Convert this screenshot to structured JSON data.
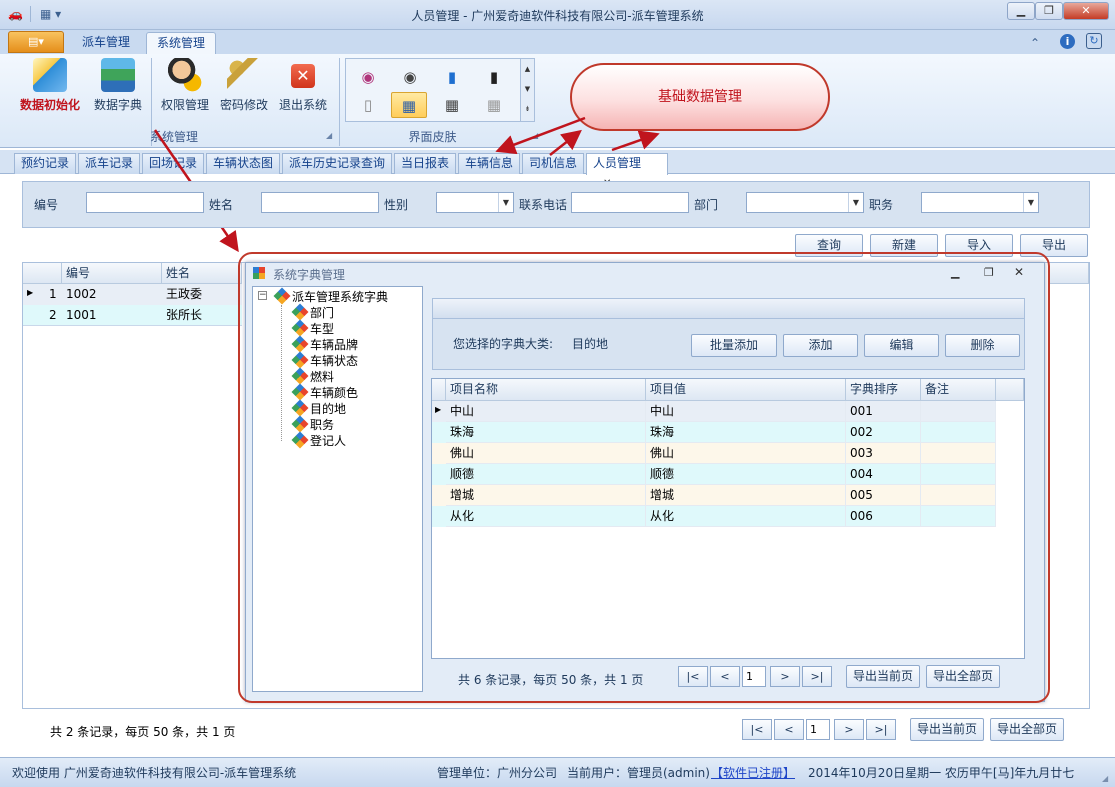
{
  "window": {
    "title": "人员管理 - 广州爱奇迪软件科技有限公司-派车管理系统",
    "min": "▁",
    "max": "❐",
    "close": "✕"
  },
  "ribbon": {
    "tabs": [
      "派车管理",
      "系统管理"
    ],
    "app_button": "▤▾",
    "buttons": [
      "数据初始化",
      "数据字典",
      "权限管理",
      "密码修改",
      "退出系统"
    ],
    "group_system": "系统管理",
    "group_skin": "界面皮肤",
    "right_icons": [
      "⌃",
      "i",
      "↻"
    ]
  },
  "callout": {
    "text": "基础数据管理"
  },
  "doc_tabs": [
    "预约记录",
    "派车记录",
    "回场记录",
    "车辆状态图",
    "派车历史记录查询",
    "当日报表",
    "车辆信息",
    "司机信息",
    "人员管理"
  ],
  "doc_tab_close": "✕",
  "filter": {
    "labels": [
      "编号",
      "姓名",
      "性别",
      "联系电话",
      "部门",
      "职务"
    ],
    "buttons": [
      "查询",
      "新建",
      "导入",
      "导出"
    ]
  },
  "main_grid": {
    "columns": [
      "编号",
      "姓名"
    ],
    "rows": [
      {
        "n": "1",
        "id": "1002",
        "name": "王政委"
      },
      {
        "n": "2",
        "id": "1001",
        "name": "张所长"
      }
    ],
    "pager_text": "共 2 条记录，每页 50 条，共 1 页",
    "page": "1",
    "export_current": "导出当前页",
    "export_all": "导出全部页"
  },
  "pager_buttons": [
    "|<",
    "<",
    ">",
    ">|"
  ],
  "dialog": {
    "title": "系统字典管理",
    "tree_root": "派车管理系统字典",
    "tree_items": [
      "部门",
      "车型",
      "车辆品牌",
      "车辆状态",
      "燃料",
      "车辆颜色",
      "目的地",
      "职务",
      "登记人"
    ],
    "selected_label": "您选择的字典大类:",
    "selected_value": "目的地",
    "buttons": [
      "批量添加",
      "添加",
      "编辑",
      "删除"
    ],
    "columns": [
      "项目名称",
      "项目值",
      "字典排序",
      "备注"
    ],
    "rows": [
      {
        "name": "中山",
        "value": "中山",
        "order": "001",
        "note": ""
      },
      {
        "name": "珠海",
        "value": "珠海",
        "order": "002",
        "note": ""
      },
      {
        "name": "佛山",
        "value": "佛山",
        "order": "003",
        "note": ""
      },
      {
        "name": "顺德",
        "value": "顺德",
        "order": "004",
        "note": ""
      },
      {
        "name": "增城",
        "value": "增城",
        "order": "005",
        "note": ""
      },
      {
        "name": "从化",
        "value": "从化",
        "order": "006",
        "note": ""
      }
    ],
    "pager_text": "共 6 条记录，每页 50 条，共 1 页",
    "page": "1",
    "export_current": "导出当前页",
    "export_all": "导出全部页"
  },
  "status": {
    "welcome": "欢迎使用 广州爱奇迪软件科技有限公司-派车管理系统",
    "unit": "管理单位：广州分公司",
    "user": "当前用户：管理员(admin)",
    "registered": "【软件已注册】",
    "date": "2014年10月20日星期一 农历甲午[马]年九月廿七"
  }
}
